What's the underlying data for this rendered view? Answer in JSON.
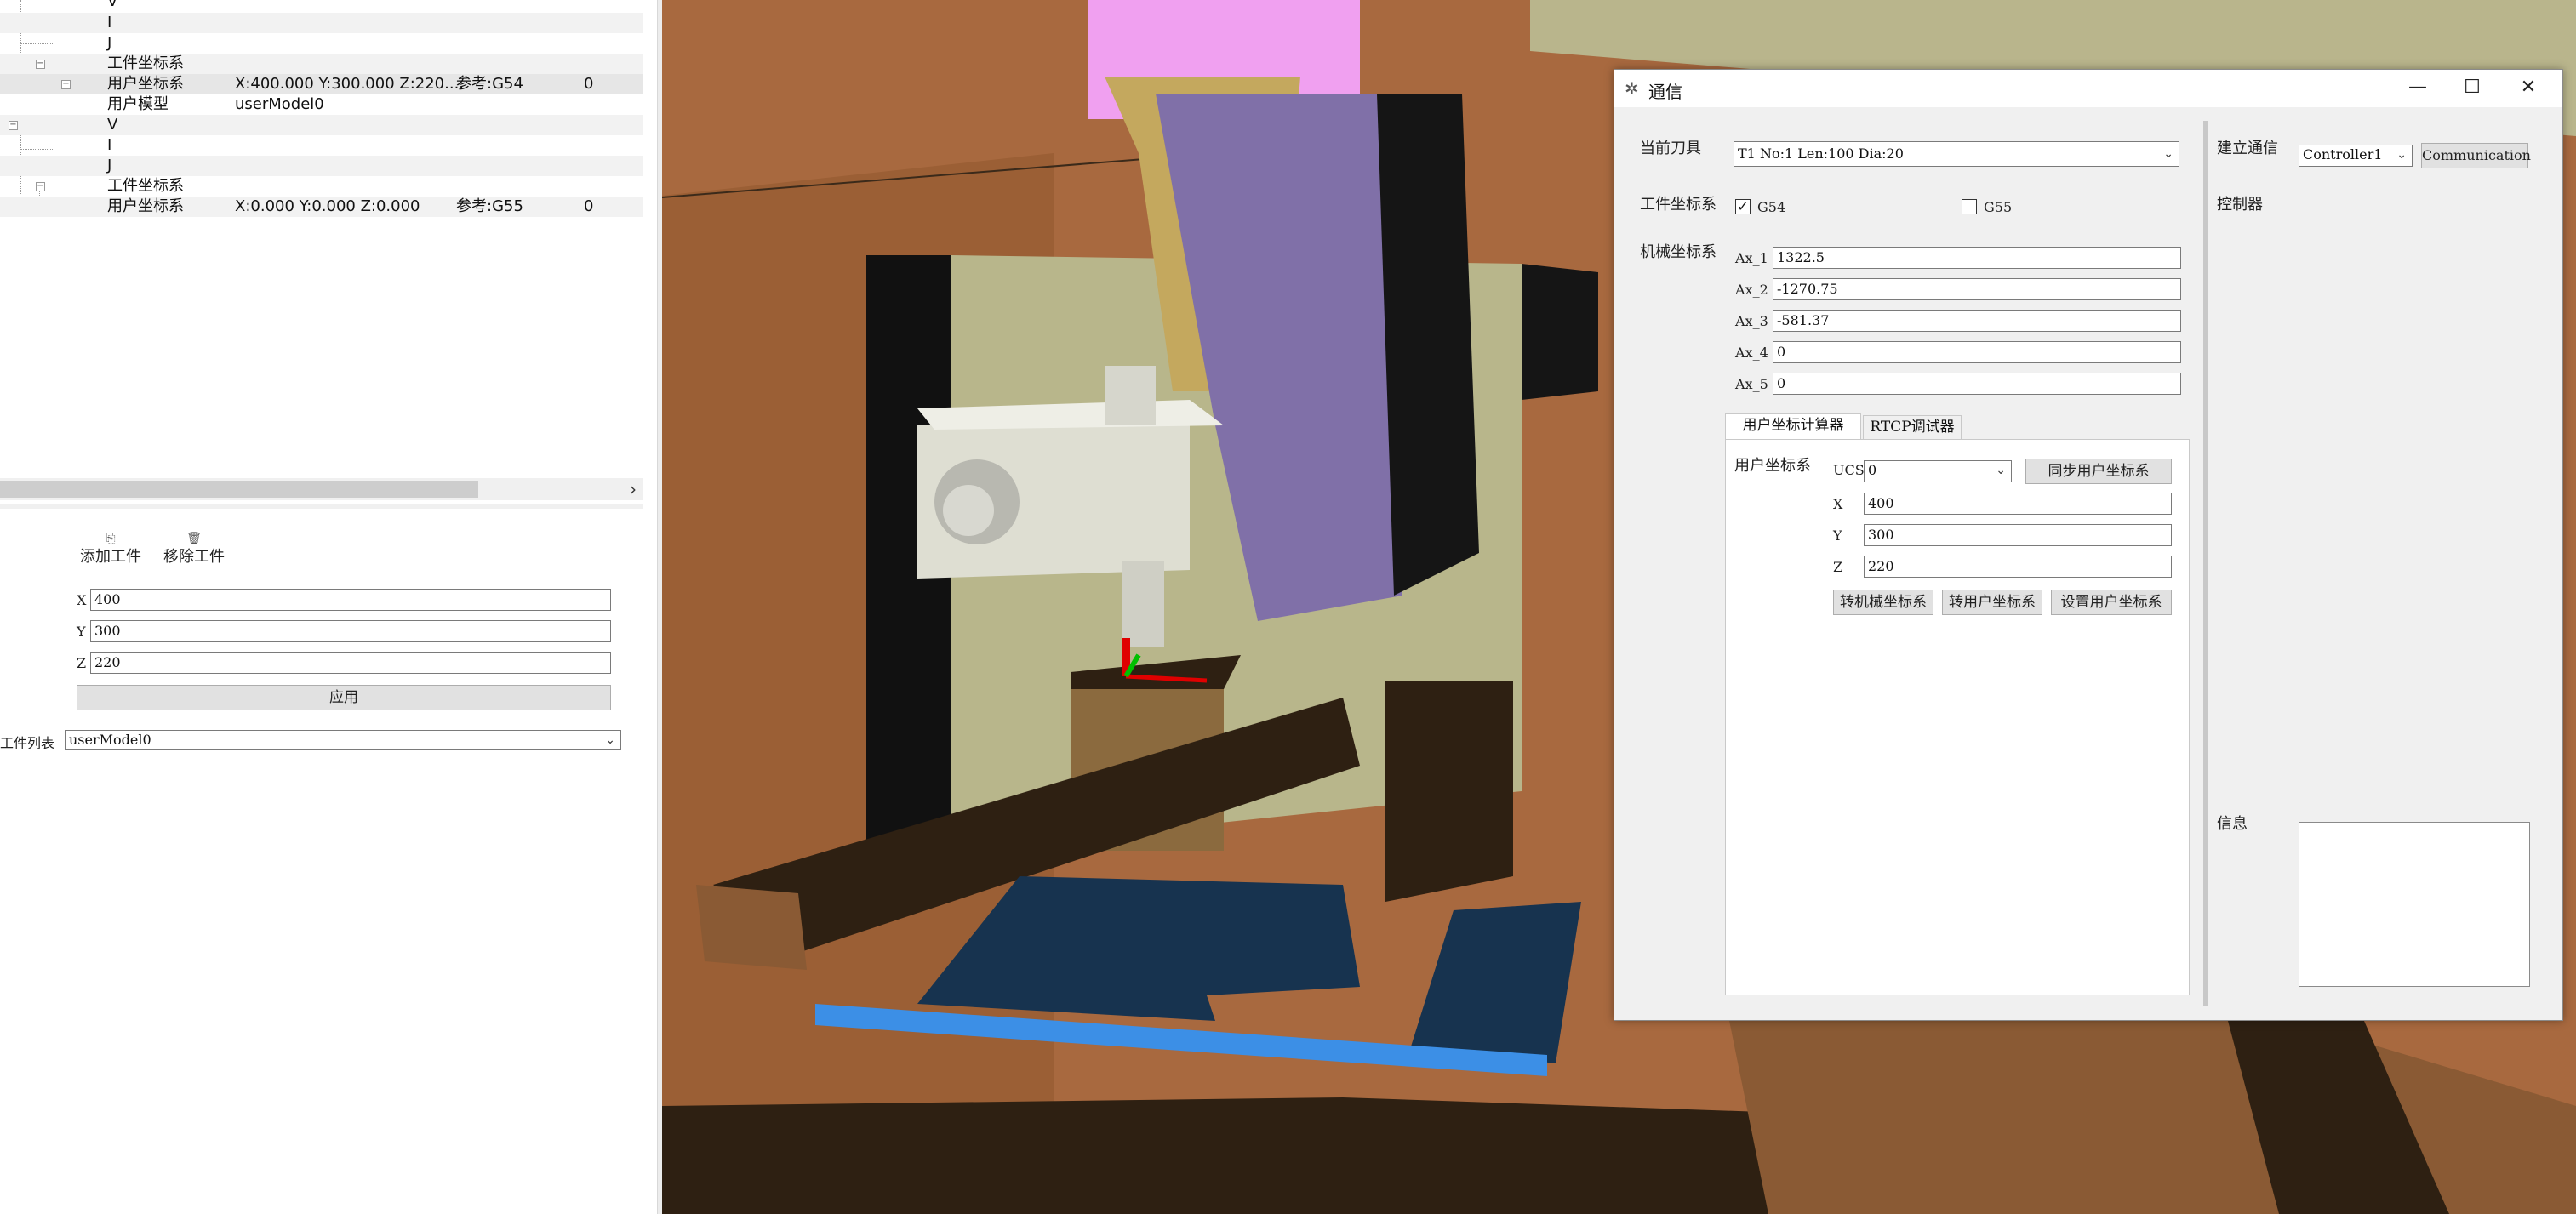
{
  "tree": {
    "rows": [
      {
        "col1": "V",
        "col2": "",
        "col3": "",
        "col4": ""
      },
      {
        "col1": "I",
        "col2": "",
        "col3": "",
        "col4": ""
      },
      {
        "col1": "J",
        "col2": "",
        "col3": "",
        "col4": ""
      },
      {
        "col1": "工件坐标系",
        "col2": "",
        "col3": "",
        "col4": ""
      },
      {
        "col1": "用户坐标系",
        "col2": "X:400.000 Y:300.000 Z:220....",
        "col3": "参考:G54",
        "col4": "0"
      },
      {
        "col1": "用户模型",
        "col2": "userModel0",
        "col3": "",
        "col4": ""
      },
      {
        "col1": "V",
        "col2": "",
        "col3": "",
        "col4": ""
      },
      {
        "col1": "I",
        "col2": "",
        "col3": "",
        "col4": ""
      },
      {
        "col1": "J",
        "col2": "",
        "col3": "",
        "col4": ""
      },
      {
        "col1": "工件坐标系",
        "col2": "",
        "col3": "",
        "col4": ""
      },
      {
        "col1": "用户坐标系",
        "col2": "X:0.000 Y:0.000 Z:0.000",
        "col3": "参考:G55",
        "col4": "0"
      }
    ]
  },
  "workpiece": {
    "add_label": "添加工件",
    "remove_label": "移除工件",
    "x_label": "X",
    "x_value": "400",
    "y_label": "Y",
    "y_value": "300",
    "z_label": "Z",
    "z_value": "220",
    "apply_label": "应用",
    "list_label": "工件列表",
    "list_value": "userModel0"
  },
  "dialog": {
    "title": "通信",
    "tool_label": "当前刀具",
    "tool_value": "T1 No:1 Len:100 Dia:20",
    "wcs_label": "工件坐标系",
    "g54_label": "G54",
    "g54_checked": true,
    "g55_label": "G55",
    "g55_checked": false,
    "mcs_label": "机械坐标系",
    "axes": [
      {
        "label": "Ax_1",
        "value": "1322.5"
      },
      {
        "label": "Ax_2",
        "value": "-1270.75"
      },
      {
        "label": "Ax_3",
        "value": "-581.37"
      },
      {
        "label": "Ax_4",
        "value": "0"
      },
      {
        "label": "Ax_5",
        "value": "0"
      }
    ],
    "tabs": [
      "用户坐标计算器",
      "RTCP调试器"
    ],
    "ucs_group_label": "用户坐标系",
    "ucs_label": "UCS",
    "ucs_value": "0",
    "sync_button": "同步用户坐标系",
    "ucs_x_label": "X",
    "ucs_x": "400",
    "ucs_y_label": "Y",
    "ucs_y": "300",
    "ucs_z_label": "Z",
    "ucs_z": "220",
    "to_mcs_button": "转机械坐标系",
    "to_ucs_button": "转用户坐标系",
    "set_ucs_button": "设置用户坐标系",
    "connect_label": "建立通信",
    "controller_value": "Controller1",
    "communication_button": "Communication",
    "controller_label": "控制器",
    "info_label": "信息",
    "minimize": "—",
    "maximize": "☐",
    "close": "✕"
  }
}
